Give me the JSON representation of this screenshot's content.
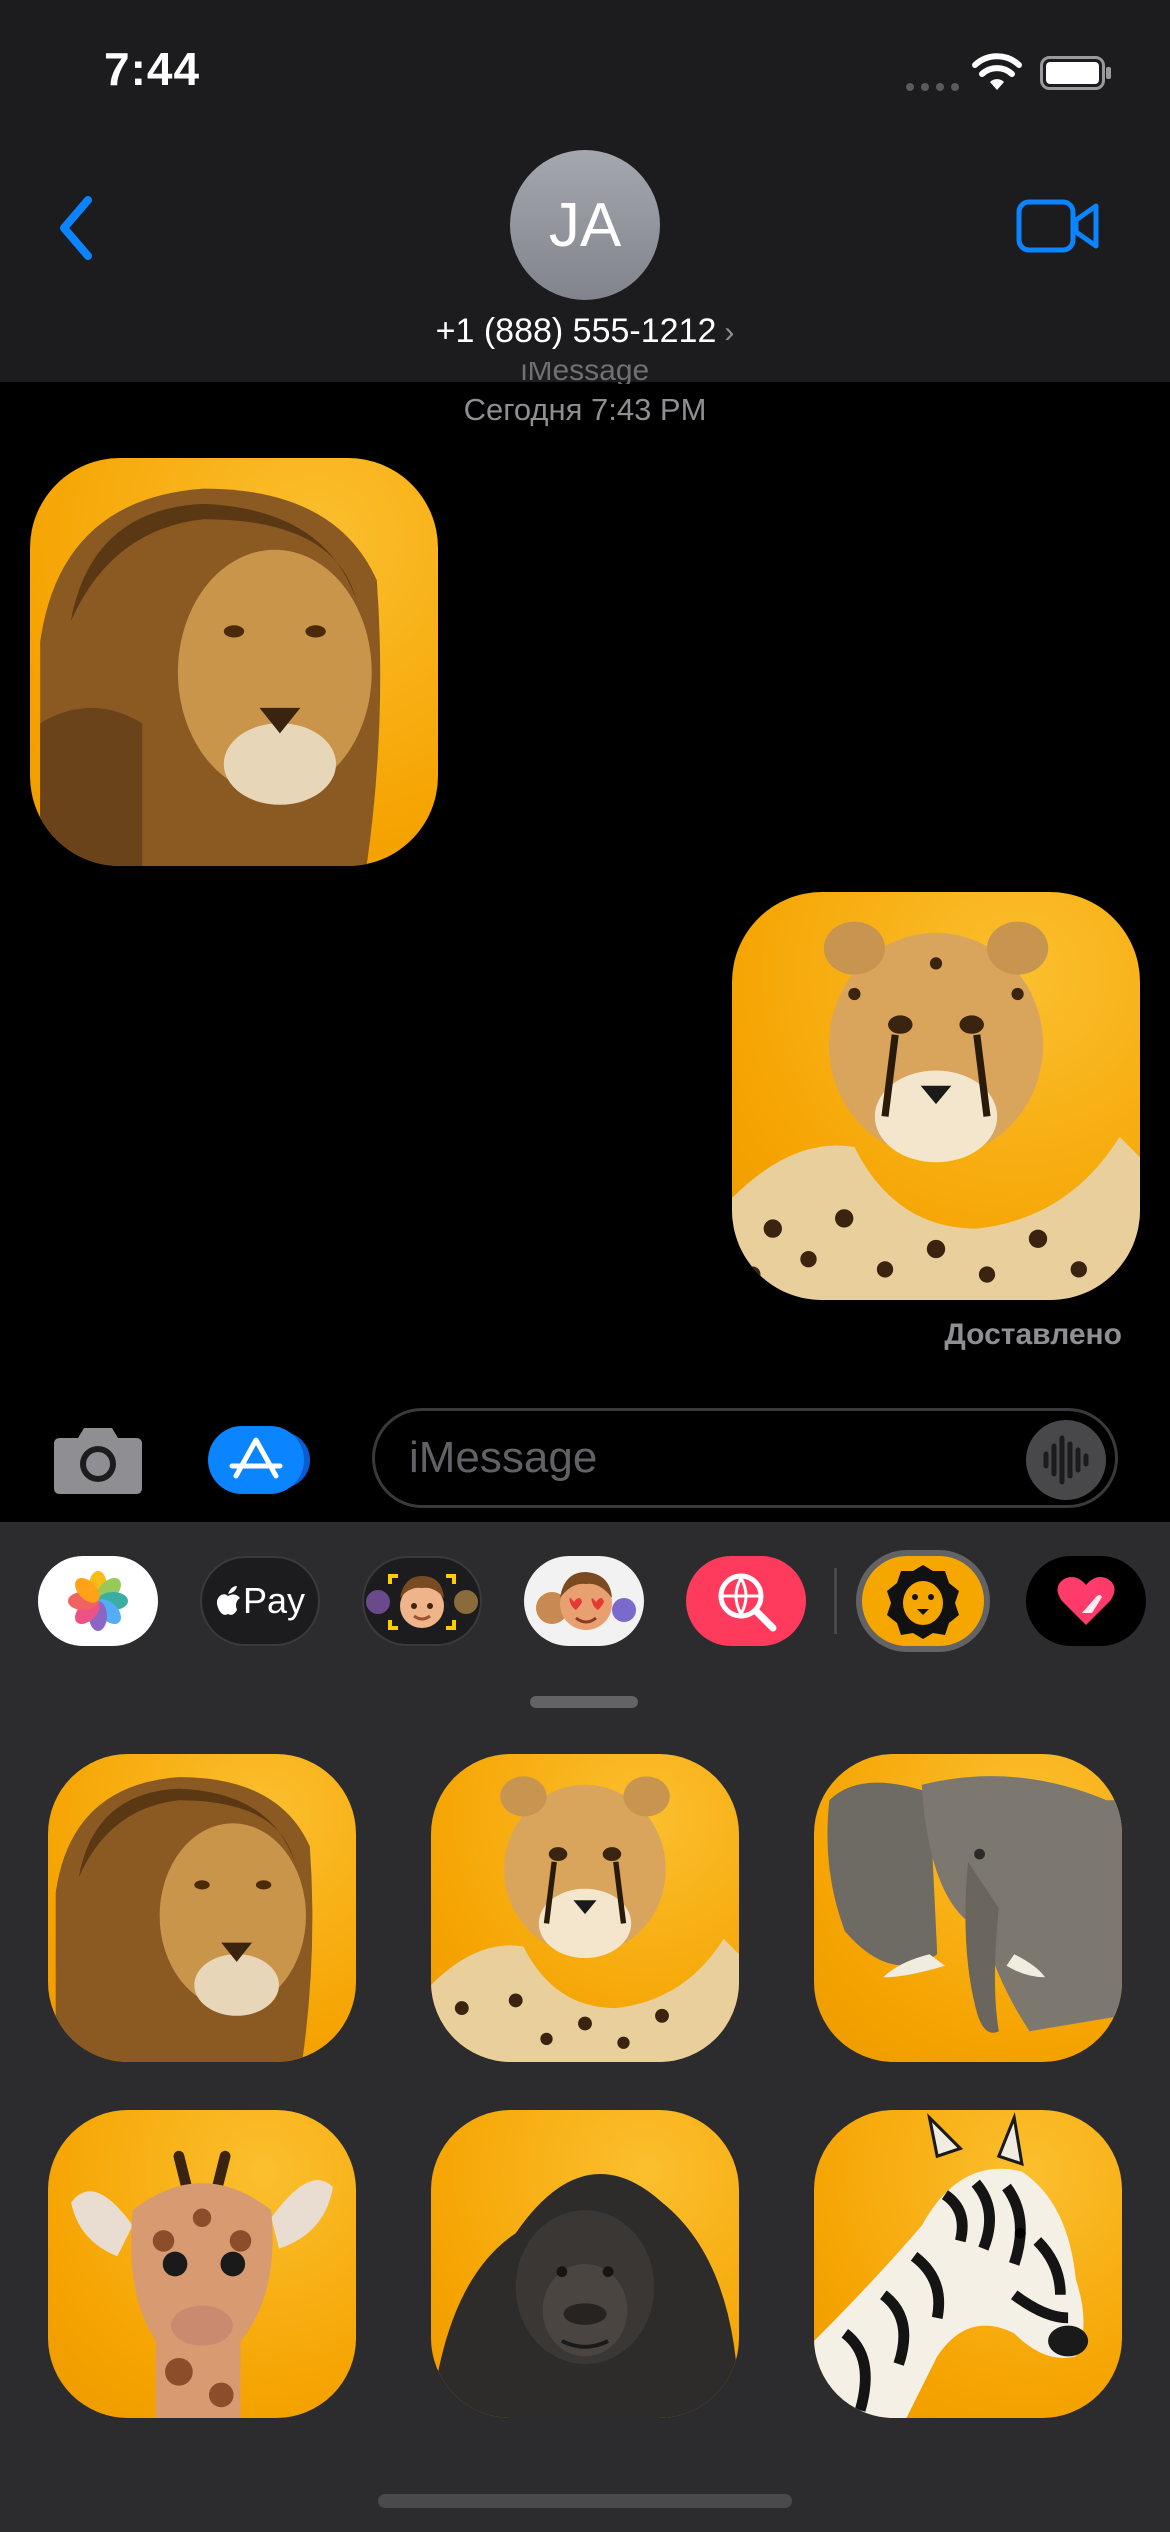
{
  "status_bar": {
    "time": "7:44"
  },
  "header": {
    "avatar_initials": "JA",
    "contact_number": "+1 (888) 555-1212",
    "chevron": "›",
    "back_icon": "chevron-left-icon",
    "video_icon": "video-camera-icon"
  },
  "conversation": {
    "service_label": "iMessage",
    "timestamp": "Сегодня 7:43 PM",
    "messages": [
      {
        "direction": "incoming",
        "sticker": "lion"
      },
      {
        "direction": "outgoing",
        "sticker": "cheetah"
      }
    ],
    "delivered_label": "Доставлено"
  },
  "input_bar": {
    "placeholder": "iMessage",
    "camera_icon": "camera-icon",
    "apps_icon": "app-store-icon",
    "voice_icon": "waveform-icon"
  },
  "app_drawer": {
    "apps": [
      "Photos",
      "Apple Pay",
      "Memoji Camera",
      "Memoji Stickers",
      "Images",
      "Animals",
      "Digital Touch"
    ],
    "selected_app": "Animals",
    "pay_label": "Pay",
    "stickers": [
      "lion",
      "cheetah",
      "elephant",
      "giraffe",
      "gorilla",
      "zebra"
    ]
  },
  "colors": {
    "accent": "#0a84ff",
    "sticker_bg": "#f5a300",
    "header_bg": "#1c1c1e",
    "drawer_bg": "#2c2c2e"
  }
}
